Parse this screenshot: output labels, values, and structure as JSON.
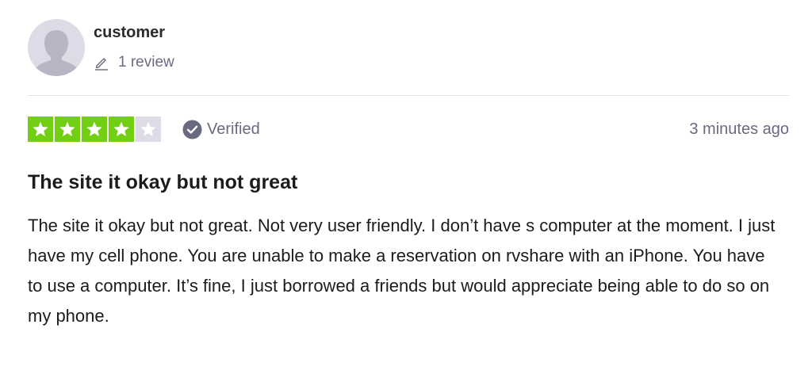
{
  "reviewer": {
    "name": "customer",
    "review_count": "1 review",
    "avatar_icon": "user-silhouette-icon",
    "count_icon": "pencil-icon"
  },
  "rating": {
    "stars": 4,
    "max_stars": 5,
    "star_color": "#73cf11",
    "empty_color": "#dcdce6"
  },
  "verified_label": "Verified",
  "timestamp": "3 minutes ago",
  "review": {
    "title": "The site it okay but not great",
    "body": "The site it okay but not great. Not very user friendly. I don’t have s computer at the moment. I just have my cell phone. You are unable to make a reservation on rvshare with an iPhone. You have to use a computer. It’s fine, I just borrowed a friends but would appreciate being able to do so on my phone."
  }
}
